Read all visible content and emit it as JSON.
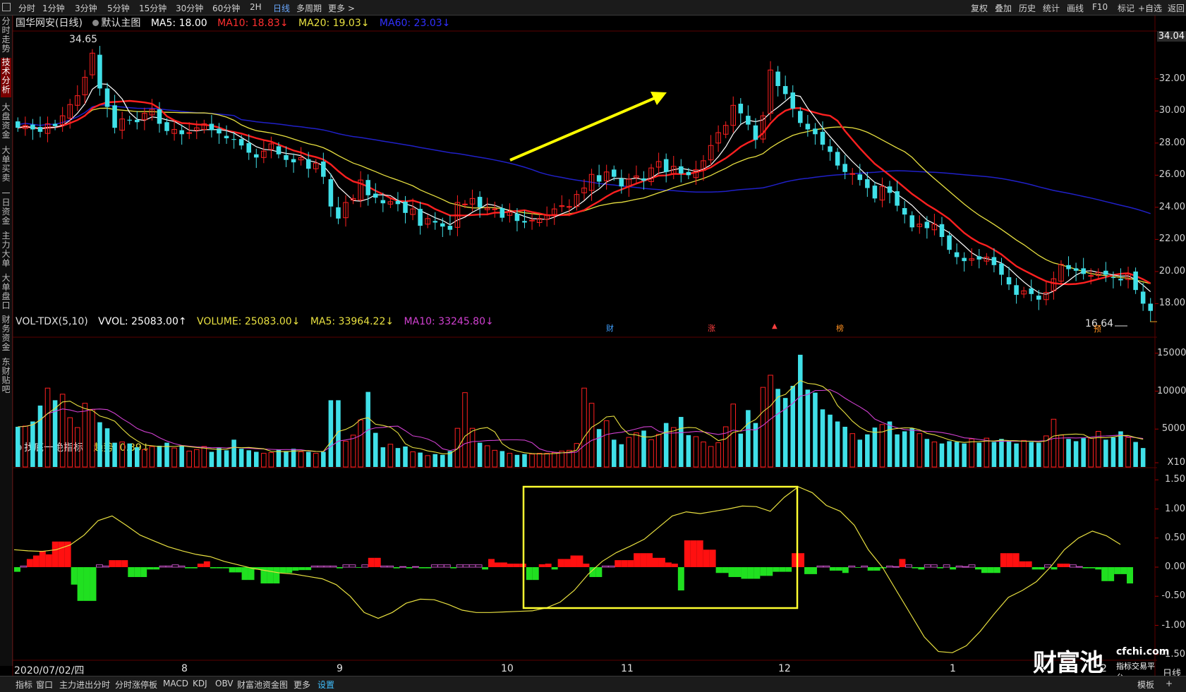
{
  "toolbar": {
    "periods": [
      "分时",
      "1分钟",
      "3分钟",
      "5分钟",
      "15分钟",
      "30分钟",
      "60分钟",
      "2H",
      "日线",
      "多周期",
      "更多 >"
    ],
    "active_period": "日线",
    "right_buttons": [
      "复权",
      "叠加",
      "历史",
      "统计",
      "画线",
      "F10",
      "标记",
      "+自选",
      "返回"
    ]
  },
  "left_nav": [
    "分时走势",
    "技术分析",
    "大盘资金",
    "大单买卖",
    "一日资金",
    "主力大单",
    "大单盘口",
    "财务资金",
    "东财贴吧"
  ],
  "left_nav_active": "技术分析",
  "main_legend": {
    "stock": "国华网安(日线)",
    "template": "默认主图",
    "ma5": "MA5: 18.00",
    "ma10": "MA10: 18.83↓",
    "ma20": "MA20: 19.03↓",
    "ma60": "MA60: 23.03↓"
  },
  "vol_legend": {
    "name": "VOL-TDX(5,10)",
    "vvol": "VVOL: 25083.00↑",
    "volume": "VOLUME: 25083.00↓",
    "ma5": "MA5: 33964.22↓",
    "ma10": "MA10: 33245.80↓"
  },
  "ind_legend": {
    "name": "找底一绝指标",
    "trend": "趋势: 0.39↓"
  },
  "price_axis": [
    "34.04",
    "32.00",
    "30.00",
    "28.00",
    "26.00",
    "24.00",
    "22.00",
    "20.00",
    "18.00"
  ],
  "vol_axis": [
    "15000",
    "10000",
    "5000",
    "X10"
  ],
  "ind_axis": [
    "1.50",
    "1.00",
    "0.50",
    "0.00",
    "-0.50",
    "-1.00",
    "-1.50"
  ],
  "annotations": {
    "high_label": "34.65",
    "low_label": "16.64",
    "event_markers": [
      "财",
      "涨",
      "▲",
      "榜",
      "预"
    ]
  },
  "date_axis": {
    "first": "2020/07/02/四",
    "months": [
      "8",
      "9",
      "10",
      "11",
      "12",
      "1",
      "2"
    ],
    "right_label": "日线"
  },
  "watermark": {
    "brand": "财富池",
    "site": "cfchi.com",
    "tagline": "指标交易平台"
  },
  "bottom_tabs": [
    "指标",
    "窗口",
    "主力进出分时",
    "分时涨停板",
    "MACD",
    "KDJ",
    "OBV",
    "财富池资金图",
    "更多",
    "设置"
  ],
  "bottom_right": [
    "模板",
    "+"
  ],
  "colors": {
    "up": "#ff2020",
    "down": "#40e0e8",
    "ma5": "#ffffff",
    "ma10": "#ff2020",
    "ma20": "#e8e040",
    "ma60": "#2020c8",
    "vol_ma10": "#d040d0",
    "ind_pos": "#ff1010",
    "ind_neg": "#20e020",
    "trend": "#e8e040",
    "box": "#ffff30",
    "arrow": "#ffff00"
  },
  "chart_data": [
    {
      "type": "candlestick",
      "title": "国华网安(日线)",
      "ylim": [
        16.0,
        34.8
      ],
      "grid": false,
      "close": [
        28.95,
        29.1,
        28.85,
        28.7,
        29.2,
        29.05,
        29.7,
        30.4,
        30.95,
        32.1,
        33.6,
        31.4,
        30.25,
        28.95,
        29.5,
        29.4,
        29.3,
        29.85,
        30.1,
        29.2,
        28.75,
        28.85,
        28.55,
        28.65,
        28.95,
        29.2,
        28.8,
        28.6,
        28.3,
        28.2,
        27.85,
        27.4,
        27.1,
        27.5,
        27.95,
        27.3,
        26.95,
        26.8,
        27.1,
        26.4,
        26.75,
        25.9,
        24.05,
        23.3,
        24.3,
        24.55,
        25.7,
        24.75,
        24.6,
        24.25,
        24.35,
        24.2,
        23.65,
        23.9,
        22.85,
        23.3,
        23.05,
        22.8,
        22.6,
        24.3,
        24.2,
        24.55,
        24.0,
        23.95,
        23.9,
        23.35,
        23.7,
        23.15,
        23.05,
        23.2,
        23.3,
        23.5,
        23.9,
        24.1,
        24.05,
        24.8,
        25.2,
        26.05,
        25.6,
        26.2,
        25.9,
        25.3,
        25.75,
        25.95,
        25.65,
        26.45,
        26.85,
        26.2,
        26.55,
        26.1,
        26.0,
        26.35,
        26.9,
        27.85,
        28.65,
        29.1,
        30.35,
        29.85,
        29.15,
        28.2,
        29.7,
        32.55,
        31.55,
        31.05,
        30.15,
        29.25,
        28.85,
        28.55,
        27.9,
        27.45,
        26.6,
        26.2,
        26.1,
        25.7,
        25.2,
        24.55,
        25.3,
        24.9,
        24.1,
        23.55,
        22.75,
        22.95,
        22.7,
        22.95,
        22.15,
        21.35,
        20.9,
        20.65,
        20.8,
        20.75,
        20.9,
        20.4,
        19.8,
        19.2,
        18.55,
        18.8,
        18.6,
        18.25,
        18.7,
        19.55,
        20.45,
        20.15,
        20.05,
        19.85,
        19.75,
        19.95,
        19.8,
        19.6,
        19.45,
        19.85,
        18.85,
        18.0,
        17.55
      ],
      "last_close": "18.00",
      "period_high": 34.65,
      "period_low": 16.64
    },
    {
      "type": "line",
      "title": "MA lines",
      "series": [
        {
          "name": "MA5"
        },
        {
          "name": "MA10"
        },
        {
          "name": "MA20"
        },
        {
          "name": "MA60"
        }
      ]
    },
    {
      "type": "bar",
      "title": "VOL-TDX(5,10)",
      "ylim": [
        0,
        16000
      ],
      "values": [
        5300,
        5400,
        6000,
        8100,
        10400,
        8800,
        9600,
        6500,
        5200,
        8400,
        7600,
        5900,
        5100,
        3200,
        3300,
        3100,
        2600,
        2300,
        2700,
        2800,
        3200,
        2500,
        2800,
        2100,
        2300,
        2700,
        2000,
        2500,
        2200,
        3600,
        2400,
        2200,
        2000,
        1800,
        1900,
        2300,
        2100,
        2400,
        2000,
        2000,
        1800,
        2000,
        8800,
        8800,
        3400,
        4200,
        6200,
        9900,
        4500,
        2600,
        3000,
        2500,
        2700,
        2000,
        1900,
        1500,
        1700,
        1600,
        2100,
        5100,
        9800,
        5100,
        3200,
        2800,
        2200,
        2100,
        1800,
        1600,
        1700,
        1700,
        1800,
        1800,
        1900,
        2100,
        2200,
        3100,
        10400,
        8400,
        5000,
        6100,
        3600,
        3000,
        3900,
        4500,
        4800,
        3600,
        4300,
        5800,
        5200,
        6600,
        4200,
        4000,
        3300,
        2700,
        3200,
        5300,
        8300,
        4400,
        7500,
        5800,
        10500,
        12100,
        10300,
        9100,
        10700,
        14800,
        10200,
        9800,
        7600,
        6900,
        6000,
        5300,
        4400,
        3600,
        4300,
        5200,
        5600,
        6000,
        4300,
        4700,
        5100,
        4400,
        3700,
        3300,
        3100,
        3400,
        3300,
        3100,
        3700,
        3200,
        3800,
        3300,
        3700,
        3400,
        3100,
        3500,
        3300,
        3200,
        4100,
        6300,
        4200,
        3700,
        3400,
        3800,
        3800,
        4700,
        3600,
        3900,
        4700,
        3900,
        3300,
        2500
      ]
    },
    {
      "type": "bar",
      "title": "找底一绝指标",
      "ylim": [
        -1.6,
        1.6
      ],
      "values": [
        -0.08,
        0.02,
        0.14,
        0.2,
        0.28,
        0.22,
        0.44,
        0.44,
        0.44,
        -0.3,
        -0.58,
        -0.58,
        -0.58,
        0.04,
        0.02,
        0.12,
        0.12,
        0.12,
        -0.17,
        -0.17,
        -0.17,
        -0.04,
        -0.04,
        0.02,
        0.02,
        0.04,
        0.02,
        -0.02,
        -0.02,
        0.06,
        0.1,
        -0.02,
        -0.02,
        -0.02,
        -0.09,
        -0.09,
        -0.22,
        -0.22,
        -0.04,
        -0.28,
        -0.28,
        -0.28,
        -0.1,
        -0.1,
        -0.06,
        -0.05,
        -0.05,
        0.02,
        0.02,
        0.02,
        0.02,
        -0.02,
        0.04,
        0.04,
        -0.01,
        0.04,
        0.16,
        0.16,
        0.02,
        0.02,
        -0.02,
        0.01,
        -0.02,
        0.01,
        -0.02,
        -0.02,
        0.04,
        0.04,
        0.04,
        -0.02,
        0.04,
        0.04,
        0.04,
        0.04,
        -0.04,
        0.14,
        0.08,
        0.08,
        0.06,
        0.06,
        0.06,
        -0.22,
        -0.22,
        0.05,
        0.06,
        -0.04,
        0.14,
        0.14,
        0.2,
        0.2,
        0.06,
        -0.17,
        -0.17,
        0.02,
        0.02,
        0.12,
        0.12,
        0.12,
        0.24,
        0.24,
        0.24,
        0.16,
        0.16,
        0.08,
        0.06,
        -0.4,
        0.46,
        0.46,
        0.46,
        0.3,
        0.3,
        -0.1,
        -0.1,
        -0.17,
        -0.17,
        -0.2,
        -0.2,
        -0.2,
        -0.15,
        -0.15,
        -0.08,
        -0.08,
        -0.08,
        0.24,
        0.24,
        -0.12,
        -0.12,
        0.02,
        0.02,
        -0.06,
        -0.06,
        -0.1,
        0.02,
        -0.01,
        0.02,
        -0.06,
        -0.06,
        -0.02,
        0.02,
        0.01,
        0.14,
        0.04,
        -0.02,
        -0.04,
        0.04,
        0.04,
        -0.02,
        0.04,
        -0.04,
        0.02,
        0.01,
        0.04,
        -0.04,
        -0.1,
        -0.1,
        -0.1,
        0.24,
        0.24,
        0.24,
        0.1,
        0.1,
        -0.04,
        -0.04,
        0.04,
        -0.04,
        0.06,
        0.06,
        0.04,
        0.01,
        -0.02,
        -0.02,
        -0.04,
        -0.24,
        -0.24,
        -0.12,
        -0.12,
        -0.28
      ],
      "trend": [
        0.3,
        0.28,
        0.27,
        0.3,
        0.38,
        0.55,
        0.8,
        0.88,
        0.72,
        0.55,
        0.45,
        0.35,
        0.28,
        0.22,
        0.18,
        0.1,
        0.04,
        -0.02,
        -0.06,
        -0.1,
        -0.12,
        -0.16,
        -0.2,
        -0.3,
        -0.5,
        -0.78,
        -0.88,
        -0.78,
        -0.62,
        -0.55,
        -0.56,
        -0.64,
        -0.74,
        -0.78,
        -0.78,
        -0.77,
        -0.76,
        -0.75,
        -0.7,
        -0.6,
        -0.4,
        -0.12,
        0.1,
        0.25,
        0.36,
        0.48,
        0.68,
        0.88,
        0.95,
        0.92,
        0.96,
        1.0,
        1.05,
        1.04,
        0.96,
        1.2,
        1.38,
        1.28,
        1.06,
        0.96,
        0.72,
        0.3,
        0.0,
        -0.4,
        -0.8,
        -1.2,
        -1.45,
        -1.47,
        -1.35,
        -1.1,
        -0.8,
        -0.52,
        -0.4,
        -0.25,
        0.0,
        0.3,
        0.5,
        0.62,
        0.54,
        0.39
      ]
    }
  ]
}
